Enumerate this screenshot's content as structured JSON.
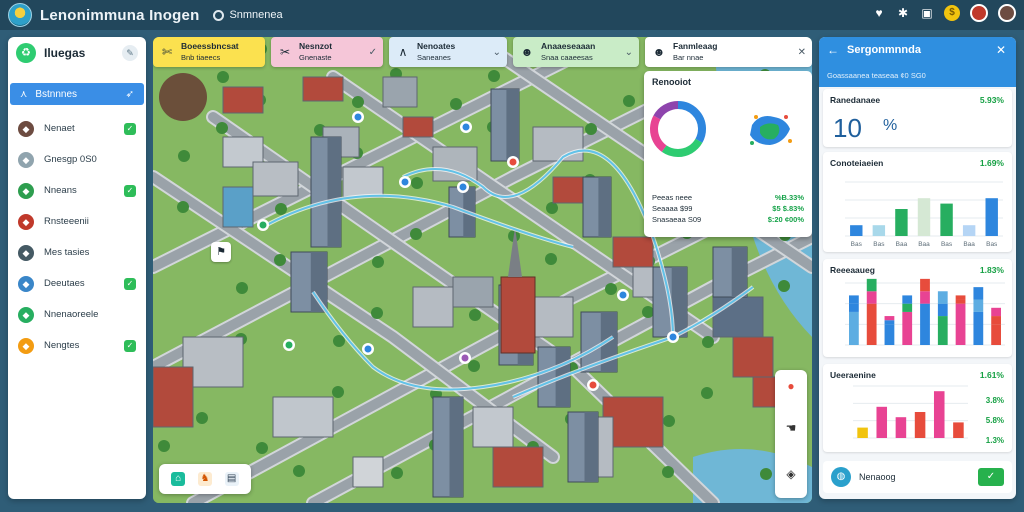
{
  "app": {
    "title": "Lenonimmuna Inogen",
    "subtitle": "Snmnenea"
  },
  "topbar": {
    "coin": "$"
  },
  "sidebar": {
    "title": "Iluegas",
    "active": {
      "label": "Bstnnnes"
    },
    "items": [
      {
        "label": "Nenaet",
        "color": "#6d4c41",
        "checked": true
      },
      {
        "label": "Gnesgp 0S0",
        "color": "#90a4ae",
        "checked": false
      },
      {
        "label": "Nneans",
        "color": "#2e9e4f",
        "checked": true
      },
      {
        "label": "Rnsteeenii",
        "color": "#c0392b",
        "checked": false
      },
      {
        "label": "Mes tasies",
        "color": "#455a64",
        "checked": false
      },
      {
        "label": "Deeutaes",
        "color": "#3a86c8",
        "checked": true
      },
      {
        "label": "Nnenaoreele",
        "color": "#27ae60",
        "checked": false
      },
      {
        "label": "Nengtes",
        "color": "#f39c12",
        "checked": true
      }
    ]
  },
  "map_cards": [
    {
      "title": "Boeessbncsat",
      "sub": "Bnb tiaeecs",
      "bg": "#fbe14f"
    },
    {
      "title": "Nesnzot",
      "sub": "Gnenaste",
      "bg": "#f5c6d8"
    },
    {
      "title": "Nenoates",
      "sub": "Saneanes",
      "bg": "#dcebf8"
    },
    {
      "title": "Anaaeseaaan",
      "sub": "Snaa caaeesas",
      "bg": "#c9ecc7"
    },
    {
      "title": "Fanmleaag",
      "sub": "Bar nnae",
      "bg": "#ffffff"
    }
  ],
  "stats_card": {
    "title": "Renooiot",
    "rows": [
      {
        "label": "Peeas neee",
        "value": "%B.33%"
      },
      {
        "label": "Seaaaa  $99",
        "value": "$5 $.83%"
      },
      {
        "label": "Snasaeaa S09",
        "value": "$:20 ¢00%"
      }
    ]
  },
  "rpanel": {
    "title": "Sergonmnnda",
    "subtitle": "Goassaanea teaseaa ¢0 SG0",
    "kpi": {
      "title": "Ranedanaee",
      "value": "5.93%",
      "big": "10",
      "unit": "%"
    },
    "cards": [
      {
        "title": "Conoteiaeien",
        "value": "1.69%"
      },
      {
        "title": "Reeeaaueg",
        "value": "1.83%"
      },
      {
        "title": "Ueeraenine",
        "value": "1.61%",
        "side": [
          "3.8%",
          "5.8%",
          "1.3%"
        ]
      }
    ],
    "footer": {
      "label": "Nenaoog"
    }
  },
  "chart_data": [
    {
      "type": "bar",
      "categories": [
        "Bas",
        "Bas",
        "Baa",
        "Baa",
        "Bas",
        "Baa",
        "Bas"
      ],
      "values": [
        4,
        4,
        10,
        14,
        12,
        4,
        14
      ],
      "ylim": [
        0,
        20
      ]
    },
    {
      "type": "bar",
      "series": [
        {
          "values": [
            8,
            10,
            5,
            8,
            10,
            7,
            10,
            8,
            5
          ]
        },
        {
          "values": [
            2,
            3,
            1,
            2,
            3,
            3,
            1,
            3,
            2
          ]
        },
        {
          "values": [
            2,
            3,
            1,
            2,
            3,
            3,
            1,
            3,
            2
          ]
        }
      ],
      "ylim": [
        0,
        15
      ]
    },
    {
      "type": "bar",
      "values": [
        2,
        6,
        4,
        5,
        9,
        3
      ],
      "ylim": [
        0,
        10
      ]
    }
  ]
}
